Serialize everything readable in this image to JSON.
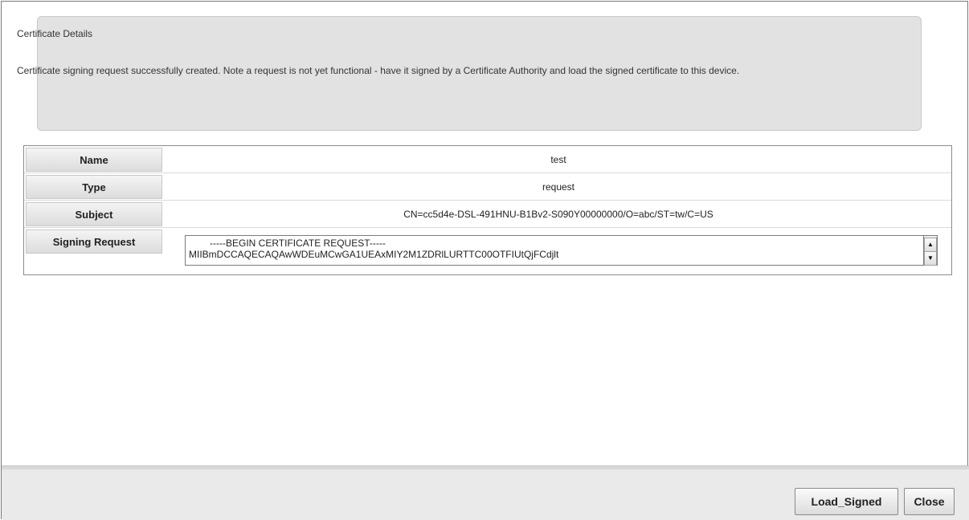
{
  "info": {
    "title": "Certificate Details",
    "message": "Certificate signing request successfully created. Note a request is not yet functional - have it signed by a Certificate Authority and load the signed certificate to this device."
  },
  "details": {
    "rows": [
      {
        "label": "Name",
        "value": "test"
      },
      {
        "label": "Type",
        "value": "request"
      },
      {
        "label": "Subject",
        "value": "CN=cc5d4e-DSL-491HNU-B1Bv2-S090Y00000000/O=abc/ST=tw/C=US"
      }
    ],
    "signing_request": {
      "label": "Signing Request",
      "line1": "-----BEGIN CERTIFICATE REQUEST-----",
      "line2": "MIIBmDCCAQECAQAwWDEuMCwGA1UEAxMIY2M1ZDRlLURTTC00OTFIUtQjFCdjlt"
    }
  },
  "buttons": {
    "load_signed": "Load_Signed",
    "close": "Close"
  },
  "icons": {
    "scroll_up": "scroll-up-icon",
    "scroll_down": "scroll-down-icon"
  }
}
